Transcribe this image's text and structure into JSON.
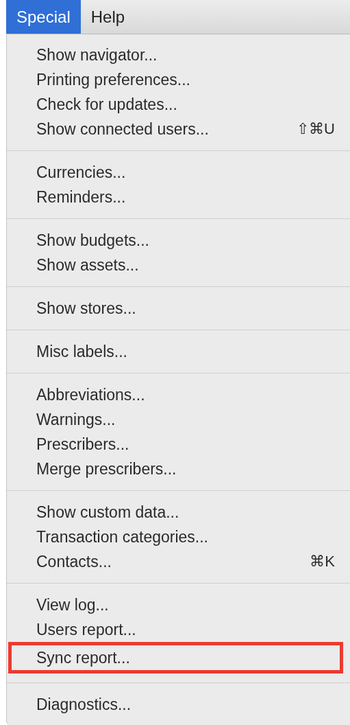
{
  "menubar": [
    {
      "label": "Special",
      "selected": true
    },
    {
      "label": "Help",
      "selected": false
    }
  ],
  "menu": {
    "groups": [
      {
        "items": [
          {
            "label": "Show navigator...",
            "highlighted": false
          },
          {
            "label": "Printing preferences...",
            "highlighted": false
          },
          {
            "label": "Check for updates...",
            "highlighted": false
          },
          {
            "label": "Show connected users...",
            "shortcut": "⇧⌘U",
            "highlighted": false
          }
        ]
      },
      {
        "items": [
          {
            "label": "Currencies...",
            "highlighted": false
          },
          {
            "label": "Reminders...",
            "highlighted": false
          }
        ]
      },
      {
        "items": [
          {
            "label": "Show budgets...",
            "highlighted": false
          },
          {
            "label": "Show assets...",
            "highlighted": false
          }
        ]
      },
      {
        "items": [
          {
            "label": "Show stores...",
            "highlighted": false
          }
        ]
      },
      {
        "items": [
          {
            "label": "Misc labels...",
            "highlighted": false
          }
        ]
      },
      {
        "items": [
          {
            "label": "Abbreviations...",
            "highlighted": false
          },
          {
            "label": "Warnings...",
            "highlighted": false
          },
          {
            "label": "Prescribers...",
            "highlighted": false
          },
          {
            "label": "Merge prescribers...",
            "highlighted": false
          }
        ]
      },
      {
        "items": [
          {
            "label": "Show custom data...",
            "highlighted": false
          },
          {
            "label": "Transaction categories...",
            "highlighted": false
          },
          {
            "label": "Contacts...",
            "shortcut": "⌘K",
            "highlighted": false
          }
        ]
      },
      {
        "items": [
          {
            "label": "View log...",
            "highlighted": false
          },
          {
            "label": "Users report...",
            "highlighted": false
          },
          {
            "label": "Sync report...",
            "highlighted": true
          }
        ]
      },
      {
        "items": [
          {
            "label": "Diagnostics...",
            "highlighted": false
          }
        ]
      }
    ]
  }
}
